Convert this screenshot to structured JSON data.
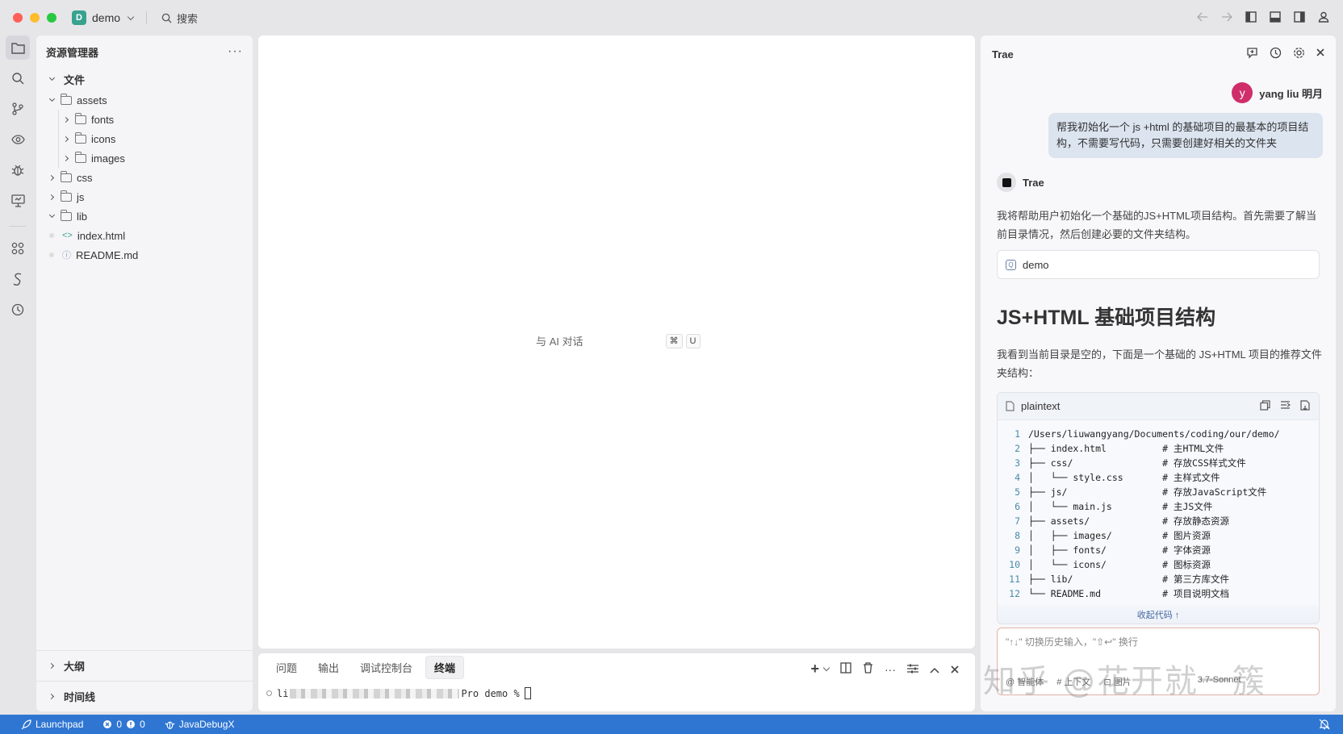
{
  "window": {
    "workspace_badge": "D",
    "workspace_name": "demo",
    "search_label": "搜索"
  },
  "explorer": {
    "title": "资源管理器",
    "more": "···",
    "section": "文件",
    "tree": [
      {
        "label": "assets",
        "depth": 0,
        "kind": "folder",
        "state": "open"
      },
      {
        "label": "fonts",
        "depth": 1,
        "kind": "folder",
        "state": "closed"
      },
      {
        "label": "icons",
        "depth": 1,
        "kind": "folder",
        "state": "closed"
      },
      {
        "label": "images",
        "depth": 1,
        "kind": "folder",
        "state": "closed"
      },
      {
        "label": "css",
        "depth": 0,
        "kind": "folder",
        "state": "closed"
      },
      {
        "label": "js",
        "depth": 0,
        "kind": "folder",
        "state": "closed"
      },
      {
        "label": "lib",
        "depth": 0,
        "kind": "folder",
        "state": "open"
      },
      {
        "label": "index.html",
        "depth": 0,
        "kind": "html-file"
      },
      {
        "label": "README.md",
        "depth": 0,
        "kind": "md-file"
      }
    ],
    "outline": "大纲",
    "timeline": "时间线"
  },
  "editor": {
    "ai_hint": "与 AI 对话",
    "shortcut_cmd": "⌘",
    "shortcut_key": "U"
  },
  "panel": {
    "tabs": [
      "问题",
      "输出",
      "调试控制台",
      "终端"
    ],
    "active_tab": "终端",
    "terminal_prefix": "li",
    "terminal_suffix": "Pro demo %"
  },
  "ai": {
    "title": "Trae",
    "user_initial": "y",
    "user_name": "yang liu 明月",
    "user_message": "帮我初始化一个 js +html 的基础项目的最基本的项目结构，不需要写代码，只需要创建好相关的文件夹",
    "bot_name": "Trae",
    "bot_intro": "我将帮助用户初始化一个基础的JS+HTML项目结构。首先需要了解当前目录情况，然后创建必要的文件夹结构。",
    "context_chip": "demo",
    "heading": "JS+HTML 基础项目结构",
    "para": "我看到当前目录是空的，下面是一个基础的 JS+HTML 项目的推荐文件夹结构：",
    "code_lang": "plaintext",
    "code_lines": [
      {
        "n": "1",
        "text": "/Users/liuwangyang/Documents/coding/our/demo/"
      },
      {
        "n": "2",
        "text": "├── index.html          # 主HTML文件"
      },
      {
        "n": "3",
        "text": "├── css/                # 存放CSS样式文件"
      },
      {
        "n": "4",
        "text": "│   └── style.css       # 主样式文件"
      },
      {
        "n": "5",
        "text": "├── js/                 # 存放JavaScript文件"
      },
      {
        "n": "6",
        "text": "│   └── main.js         # 主JS文件"
      },
      {
        "n": "7",
        "text": "├── assets/             # 存放静态资源"
      },
      {
        "n": "8",
        "text": "│   ├── images/         # 图片资源"
      },
      {
        "n": "9",
        "text": "│   ├── fonts/          # 字体资源"
      },
      {
        "n": "10",
        "text": "│   └── icons/          # 图标资源"
      },
      {
        "n": "11",
        "text": "├── lib/                # 第三方库文件"
      },
      {
        "n": "12",
        "text": "└── README.md           # 项目说明文档"
      }
    ],
    "collapse_code": "收起代码 ↑",
    "input_placeholder": "\"↑↓\" 切换历史输入，\"⇧↩\" 换行",
    "input_tools": [
      "@ 智能体",
      "# 上下文",
      "⊡ 图片"
    ],
    "model": "3.7-Sonnet",
    "watermark": "知乎 @花开就一簇"
  },
  "status": {
    "launchpad": "Launchpad",
    "errors": "0",
    "warnings": "0",
    "debug": "JavaDebugX"
  },
  "colors": {
    "accent": "#2f76d2",
    "avatar": "#cf2e6a",
    "user_bubble": "#dbe4ef",
    "workspace_badge": "#36a28f"
  }
}
